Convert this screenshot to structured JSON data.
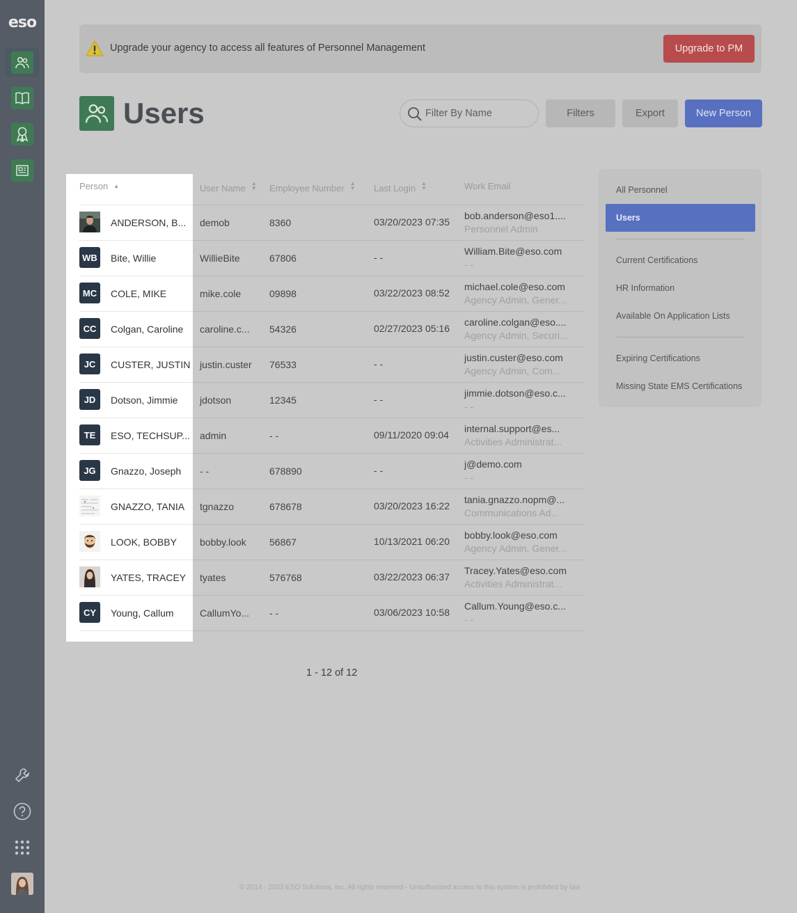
{
  "sidebar": {
    "logo": "eso",
    "nav": [
      {
        "icon": "users-icon",
        "active": true
      },
      {
        "icon": "book-icon",
        "active": false
      },
      {
        "icon": "award-icon",
        "active": false
      },
      {
        "icon": "newspaper-icon",
        "active": false
      }
    ],
    "bottom": [
      "wrench-icon",
      "help-icon",
      "apps-grid-icon",
      "user-avatar"
    ]
  },
  "banner": {
    "text": "Upgrade your agency to access all features of Personnel Management",
    "button": "Upgrade to PM"
  },
  "page": {
    "title": "Users"
  },
  "toolbar": {
    "search_placeholder": "Filter By Name",
    "filters": "Filters",
    "export": "Export",
    "new_person": "New Person"
  },
  "table": {
    "headers": {
      "person": "Person",
      "username": "User Name",
      "employee": "Employee Number",
      "login": "Last Login",
      "email": "Work Email"
    },
    "rows": [
      {
        "initials": "",
        "photo": true,
        "name": "ANDERSON, B...",
        "username": "demob",
        "employee": "8360",
        "login": "03/20/2023 07:35",
        "email": "bob.anderson@eso1....",
        "role": "Personnel Admin"
      },
      {
        "initials": "WB",
        "photo": false,
        "name": "Bite, Willie",
        "username": "WillieBite",
        "employee": "67806",
        "login": "- -",
        "email": "William.Bite@eso.com",
        "role": "- -"
      },
      {
        "initials": "MC",
        "photo": false,
        "name": "COLE, MIKE",
        "username": "mike.cole",
        "employee": "09898",
        "login": "03/22/2023 08:52",
        "email": "michael.cole@eso.com",
        "role": "Agency Admin, Gener..."
      },
      {
        "initials": "CC",
        "photo": false,
        "name": "Colgan, Caroline",
        "username": "caroline.c...",
        "employee": "54326",
        "login": "02/27/2023 05:16",
        "email": "caroline.colgan@eso....",
        "role": "Agency Admin, Securi..."
      },
      {
        "initials": "JC",
        "photo": false,
        "name": "CUSTER, JUSTIN",
        "username": "justin.custer",
        "employee": "76533",
        "login": "- -",
        "email": "justin.custer@eso.com",
        "role": "Agency Admin, Com..."
      },
      {
        "initials": "JD",
        "photo": false,
        "name": "Dotson, Jimmie",
        "username": "jdotson",
        "employee": "12345",
        "login": "- -",
        "email": "jimmie.dotson@eso.c...",
        "role": "- -"
      },
      {
        "initials": "TE",
        "photo": false,
        "name": "ESO, TECHSUP...",
        "username": "admin",
        "employee": "- -",
        "login": "09/11/2020 09:04",
        "email": "internal.support@es...",
        "role": "Activities Administrat..."
      },
      {
        "initials": "JG",
        "photo": false,
        "name": "Gnazzo, Joseph",
        "username": "- -",
        "employee": "678890",
        "login": "- -",
        "email": "j@demo.com",
        "role": "- -"
      },
      {
        "initials": "",
        "photo": true,
        "name": "GNAZZO, TANIA",
        "username": "tgnazzo",
        "employee": "678678",
        "login": "03/20/2023 16:22",
        "email": "tania.gnazzo.nopm@...",
        "role": "Communications Ad..."
      },
      {
        "initials": "",
        "photo": true,
        "name": "LOOK, BOBBY",
        "username": "bobby.look",
        "employee": "56867",
        "login": "10/13/2021 06:20",
        "email": "bobby.look@eso.com",
        "role": "Agency Admin, Gener..."
      },
      {
        "initials": "",
        "photo": true,
        "name": "YATES, TRACEY",
        "username": "tyates",
        "employee": "576768",
        "login": "03/22/2023 06:37",
        "email": "Tracey.Yates@eso.com",
        "role": "Activities Administrat..."
      },
      {
        "initials": "CY",
        "photo": false,
        "name": "Young, Callum",
        "username": "CallumYo...",
        "employee": "- -",
        "login": "03/06/2023 10:58",
        "email": "Callum.Young@eso.c...",
        "role": "- -"
      }
    ]
  },
  "right_panel": {
    "items": [
      "All Personnel",
      "Users",
      "Current Certifications",
      "HR Information",
      "Available On Application Lists",
      "Expiring Certifications",
      "Missing State EMS Certifications"
    ]
  },
  "pager": "1 - 12 of 12",
  "footer": "© 2014 - 2023 ESO Solutions, Inc. All rights reserved - Unauthorized access to this system is prohibited by law"
}
